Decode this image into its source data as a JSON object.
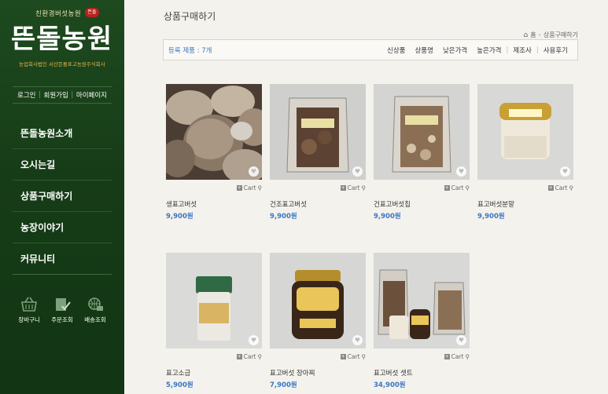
{
  "logo": {
    "subtitle": "친환경버섯농원",
    "seal": "뜬돌",
    "title": "뜬돌농원",
    "tagline": "농업회사법인 서산뜬돌표고농원주식회사"
  },
  "auth": [
    "로그인",
    "회원가입",
    "마이페이지"
  ],
  "menu": [
    "뜬돌농원소개",
    "오시는길",
    "상품구매하기",
    "농장이야기",
    "커뮤니티"
  ],
  "quick": [
    {
      "label": "장바구니",
      "icon": "shopping-basket-icon"
    },
    {
      "label": "주문조회",
      "icon": "order-check-icon"
    },
    {
      "label": "배송조회",
      "icon": "delivery-globe-icon"
    }
  ],
  "page": {
    "title": "상품구매하기",
    "breadcrumb": {
      "home": "홈",
      "current": "상품구매하기"
    },
    "count_label": "등록 제품 : 7개",
    "sorts": [
      "신상품",
      "상품명",
      "낮은가격",
      "높은가격",
      "제조사",
      "사용후기"
    ]
  },
  "cart_label": "Cart",
  "products": [
    {
      "name": "생표고버섯",
      "price": "9,900원"
    },
    {
      "name": "건조표고버섯",
      "price": "9,900원"
    },
    {
      "name": "건표고버섯칩",
      "price": "9,900원"
    },
    {
      "name": "표고버섯분말",
      "price": "9,900원"
    },
    {
      "name": "표고소금",
      "price": "5,900원"
    },
    {
      "name": "표고버섯 장아찌",
      "price": "7,900원"
    },
    {
      "name": "표고버섯 셋트",
      "price": "34,900원"
    }
  ],
  "colors": {
    "sidebar": "#1e4a1f",
    "price": "#3b76c4",
    "count": "#3b7bbf"
  }
}
